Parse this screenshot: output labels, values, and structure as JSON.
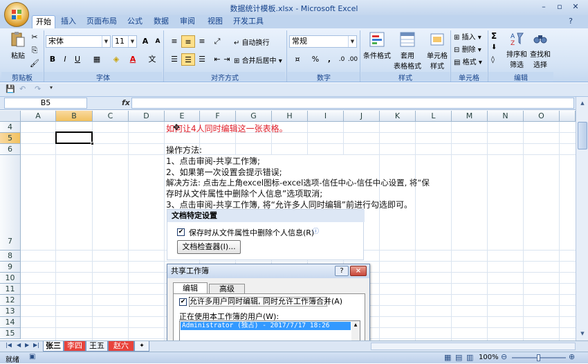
{
  "window": {
    "title": "数据统计模板.xlsx - Microsoft Excel"
  },
  "tabs": [
    "开始",
    "插入",
    "页面布局",
    "公式",
    "数据",
    "审阅",
    "视图",
    "开发工具"
  ],
  "ribbon": {
    "clipboard": {
      "paste": "粘贴",
      "label": "剪贴板"
    },
    "font": {
      "name": "宋体",
      "size": "11",
      "label": "字体",
      "bold": "B",
      "italic": "I",
      "underline": "U",
      "grow": "A",
      "shrink": "A"
    },
    "alignment": {
      "wrap": "自动换行",
      "merge": "合并后居中",
      "label": "对齐方式"
    },
    "number": {
      "format": "常规",
      "percent": "%",
      "comma": ",",
      "label": "数字"
    },
    "styles": {
      "conditional": "条件格式",
      "table_fmt_1": "套用",
      "table_fmt_2": "表格格式",
      "cell_styles_1": "单元格",
      "cell_styles_2": "样式",
      "label": "样式"
    },
    "cells": {
      "insert": "插入",
      "delete": "删除",
      "format": "格式",
      "label": "单元格"
    },
    "editing": {
      "sum": "Σ",
      "sort_1": "排序和",
      "sort_2": "筛选",
      "find_1": "查找和",
      "find_2": "选择",
      "label": "编辑"
    }
  },
  "formula_bar": {
    "name_box": "B5",
    "fx": "fx",
    "value": ""
  },
  "columns": [
    "A",
    "B",
    "C",
    "D",
    "E",
    "F",
    "G",
    "H",
    "I",
    "J",
    "K",
    "L",
    "M",
    "N",
    "O"
  ],
  "rows": [
    "4",
    "5",
    "6",
    "7",
    "8",
    "9",
    "10",
    "11",
    "12",
    "13",
    "14",
    "15"
  ],
  "sheet_text": {
    "line1": "如何让4人同时编辑这一张表格。",
    "line2": "操作方法:",
    "line3": "1、点击审阅-共享工作簿;",
    "line4": "2、如果第一次设置会提示错误;",
    "line5": "解决方法: 点击左上角excel图标-excel选项-信任中心-信任中心设置, 将“保",
    "line6": "存时从文件属性中删除个人信息”选项取消;",
    "line7": "3、点击审阅-共享工作簿, 将“允许多人同时编辑”前进行勾选即可。"
  },
  "panel": {
    "header": "文档特定设置",
    "checkbox": "保存时从文件属性中删除个人信息(R)",
    "button": "文档检查器(I)..."
  },
  "dialog": {
    "title": "共享工作簿",
    "help": "?",
    "close": "×",
    "tab_edit": "编辑",
    "tab_advanced": "高级",
    "allow": "允许多用户同时编辑, 同时允许工作簿合并(A)",
    "users_label": "正在使用本工作簿的用户(W):",
    "user": "Administrator (独占) - 2017/7/17 18:26"
  },
  "sheets": [
    "张三",
    "李四",
    "王五",
    "赵六"
  ],
  "status": {
    "ready": "就绪",
    "zoom": "100%"
  },
  "colors": {
    "accent": "#15428b",
    "red_text": "#e0202b",
    "selected_hdr": "#f1c15f"
  }
}
